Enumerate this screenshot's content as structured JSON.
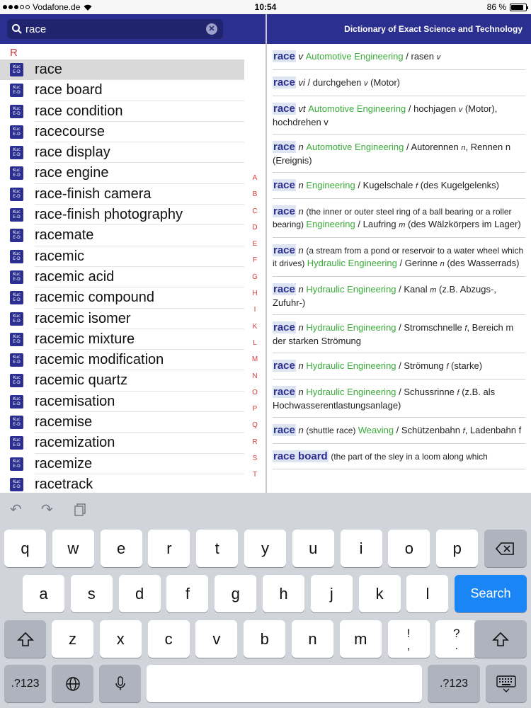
{
  "status": {
    "carrier": "Vodafone.de",
    "time": "10:54",
    "battery": "86 %",
    "battery_level": 0.86
  },
  "search": {
    "value": "race",
    "clear_icon": "clear-icon",
    "search_icon": "search-icon"
  },
  "header": {
    "title": "Dictionary of Exact Science and Technology"
  },
  "list": {
    "section": "R",
    "items": [
      "race",
      "race board",
      "race condition",
      "racecourse",
      "race display",
      "race engine",
      "race-finish camera",
      "race-finish photography",
      "racemate",
      "racemic",
      "racemic acid",
      "racemic compound",
      "racemic isomer",
      "racemic mixture",
      "racemic modification",
      "racemic quartz",
      "racemisation",
      "racemise",
      "racemization",
      "racemize",
      "racetrack"
    ],
    "dict_icon_top": "Kuc",
    "dict_icon_bottom": "E-D",
    "index": [
      "A",
      "B",
      "C",
      "D",
      "E",
      "F",
      "G",
      "H",
      "I",
      "K",
      "L",
      "M",
      "N",
      "O",
      "P",
      "Q",
      "R",
      "S",
      "T"
    ]
  },
  "entries": [
    {
      "hw": "race",
      "pos": "v",
      "field": "Automotive Engineering",
      "sep": " / ",
      "trans": "rasen",
      "gram": "v",
      "rest": ""
    },
    {
      "hw": "race",
      "pos": "vi",
      "field": "",
      "sep": " / ",
      "trans": "durchgehen",
      "gram": "v",
      "rest": " (Motor)"
    },
    {
      "hw": "race",
      "pos": "vt",
      "field": "Automotive Engineering",
      "sep": " / ",
      "trans": "hochjagen",
      "gram": "v",
      "rest": " (Motor), hochdrehen v"
    },
    {
      "hw": "race",
      "pos": "n",
      "field": "Automotive Engineering",
      "sep": " / ",
      "trans": "Autorennen",
      "gram": "n",
      "rest": ", Rennen n (Ereignis)"
    },
    {
      "hw": "race",
      "pos": "n",
      "field": "Engineering",
      "sep": " / ",
      "trans": "Kugelschale",
      "gram": "f",
      "rest": " (des Kugelgelenks)"
    },
    {
      "hw": "race",
      "pos": "n",
      "note": "(the inner or outer steel ring of a ball bearing or a roller bearing)",
      "field": "Engineering",
      "sep": " / ",
      "trans": "Laufring",
      "gram": "m",
      "rest": " (des Wälzkörpers im Lager)"
    },
    {
      "hw": "race",
      "pos": "n",
      "note": "(a stream from a pond or reservoir to a water wheel which it drives)",
      "field": "Hydraulic Engineering",
      "sep": " / ",
      "trans": "Gerinne",
      "gram": "n",
      "rest": " (des Wasserrads)"
    },
    {
      "hw": "race",
      "pos": "n",
      "field": "Hydraulic Engineering",
      "sep": " / ",
      "trans": "Kanal",
      "gram": "m",
      "rest": " (z.B. Abzugs-, Zufuhr-)"
    },
    {
      "hw": "race",
      "pos": "n",
      "field": "Hydraulic Engineering",
      "sep": " / ",
      "trans": "Stromschnelle",
      "gram": "f",
      "rest": ", Bereich m der starken Strömung"
    },
    {
      "hw": "race",
      "pos": "n",
      "field": "Hydraulic Engineering",
      "sep": " / ",
      "trans": "Strömung",
      "gram": "f",
      "rest": " (starke)"
    },
    {
      "hw": "race",
      "pos": "n",
      "field": "Hydraulic Engineering",
      "sep": " / ",
      "trans": "Schussrinne",
      "gram": "f",
      "rest": " (z.B. als Hochwasserentlastungsanlage)"
    },
    {
      "hw": "race",
      "pos": "n",
      "note": "(shuttle race)",
      "field": "Weaving",
      "sep": " / ",
      "trans": "Schützenbahn",
      "gram": "f",
      "rest": ", Ladenbahn f"
    },
    {
      "hw": "race board",
      "pos": "",
      "note": "(the part of the sley in a loom along which",
      "field": "",
      "sep": "",
      "trans": "",
      "gram": "",
      "rest": ""
    }
  ],
  "keyboard": {
    "tools": {
      "undo": "undo-icon",
      "redo": "redo-icon",
      "paste": "paste-icon"
    },
    "row1": [
      "q",
      "w",
      "e",
      "r",
      "t",
      "y",
      "u",
      "i",
      "o",
      "p"
    ],
    "row2": [
      "a",
      "s",
      "d",
      "f",
      "g",
      "h",
      "j",
      "k",
      "l"
    ],
    "row3": [
      "z",
      "x",
      "c",
      "v",
      "b",
      "n",
      "m"
    ],
    "row3_punct1": "!\n,",
    "row3_punct2": "?\n.",
    "search_label": "Search",
    "numbers_label": ".?123",
    "colors": {
      "key": "#ffffff",
      "dark_key": "#aeb3be",
      "accent": "#1a86f5",
      "bar": "#2b2f8f"
    }
  }
}
